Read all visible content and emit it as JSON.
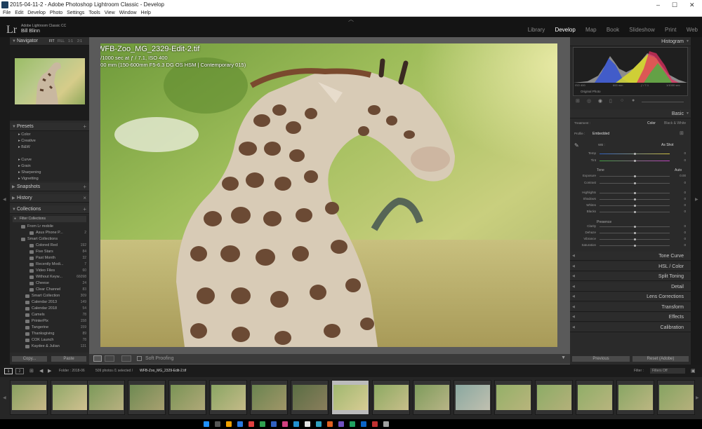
{
  "window": {
    "title": "2015-04-11-2 - Adobe Photoshop Lightroom Classic - Develop",
    "controls": [
      "–",
      "☐",
      "✕"
    ]
  },
  "menu": [
    "File",
    "Edit",
    "Develop",
    "Photo",
    "Settings",
    "Tools",
    "View",
    "Window",
    "Help"
  ],
  "brand": {
    "logo": "Lr",
    "product": "Adobe Lightroom Classic CC",
    "user": "Bill Blinn"
  },
  "modules": [
    "Library",
    "Develop",
    "Map",
    "Book",
    "Slideshow",
    "Print",
    "Web"
  ],
  "navigator": {
    "title": "Navigator",
    "zoom": [
      "FIT",
      "FILL",
      "1:1",
      "2:1"
    ]
  },
  "presets": {
    "title": "Presets",
    "items": [
      "Color",
      "Creative",
      "B&W",
      "",
      "Curve",
      "Grain",
      "Sharpening",
      "Vignetting"
    ]
  },
  "panels_left": {
    "snapshots": "Snapshots",
    "history": "History",
    "collections": "Collections",
    "filter": "Filter Collections"
  },
  "collections": [
    {
      "label": "From Lr mobile",
      "count": ""
    },
    {
      "label": "Asus Phone P...",
      "count": "2"
    },
    {
      "label": "Smart Collections",
      "count": ""
    },
    {
      "label": "Colored Red",
      "count": "192"
    },
    {
      "label": "Five Stars",
      "count": "84"
    },
    {
      "label": "Past Month",
      "count": "32"
    },
    {
      "label": "Recently Modi...",
      "count": "7"
    },
    {
      "label": "Video Files",
      "count": "60"
    },
    {
      "label": "Without Keyw...",
      "count": "66098"
    },
    {
      "label": "Cheese",
      "count": "24"
    },
    {
      "label": "Clear Channel",
      "count": "83"
    },
    {
      "label": "Smart Collection",
      "count": "309"
    },
    {
      "label": "Calendar 2013",
      "count": "149"
    },
    {
      "label": "Calendar 2018",
      "count": "54"
    },
    {
      "label": "Camels",
      "count": "78"
    },
    {
      "label": "PrinterPix",
      "count": "158"
    },
    {
      "label": "Tangerine",
      "count": "159"
    },
    {
      "label": "Thanksgiving",
      "count": "89"
    },
    {
      "label": "COK Launch",
      "count": "78"
    },
    {
      "label": "Kaydee & Julian",
      "count": "131"
    }
  ],
  "left_buttons": {
    "copy": "Copy...",
    "paste": "Paste"
  },
  "photo_info": {
    "filename": "WFB-Zoo_MG_2329-Edit-2.tif",
    "exposure": "1/1000 sec at ƒ / 7.1, ISO 400",
    "lens": "600 mm (150-600mm F5-6.3 DG OS HSM | Contemporary 015)"
  },
  "histogram": {
    "title": "Histogram",
    "iso": "ISO 400",
    "focal": "600 mm",
    "aperture": "ƒ / 7.1",
    "shutter": "1/1000 sec",
    "original": "Original Photo"
  },
  "basic": {
    "title": "Basic",
    "treatment_label": "Treatment :",
    "color": "Color",
    "bw": "Black & White",
    "profile_label": "Profile :",
    "profile": "Embedded",
    "wb_label": "WB :",
    "wb": "As Shot",
    "tone": "Tone",
    "auto": "Auto",
    "presence": "Presence"
  },
  "sliders": [
    {
      "label": "Temp",
      "value": "0"
    },
    {
      "label": "Tint",
      "value": "0"
    },
    {
      "label": "Exposure",
      "value": "0.00"
    },
    {
      "label": "Contrast",
      "value": "0"
    },
    {
      "label": "Highlights",
      "value": "0"
    },
    {
      "label": "Shadows",
      "value": "0"
    },
    {
      "label": "Whites",
      "value": "0"
    },
    {
      "label": "Blacks",
      "value": "0"
    },
    {
      "label": "Clarity",
      "value": "0"
    },
    {
      "label": "Dehaze",
      "value": "0"
    },
    {
      "label": "Vibrance",
      "value": "0"
    },
    {
      "label": "Saturation",
      "value": "0"
    }
  ],
  "right_sections": [
    "Tone Curve",
    "HSL / Color",
    "Split Toning",
    "Detail",
    "Lens Corrections",
    "Transform",
    "Effects",
    "Calibration"
  ],
  "right_buttons": {
    "previous": "Previous",
    "reset": "Reset (Adobe)"
  },
  "toolbar": {
    "soft_proofing": "Soft Proofing"
  },
  "filmstrip_bar": {
    "pages": [
      "1",
      "2"
    ],
    "folder": "Folder : 2018-06",
    "count": "509 photos /1 selected /",
    "current": "WFB-Zoo_MG_2329-Edit-2.tif",
    "filter_label": "Filter :",
    "filter": "Filters Off"
  },
  "colors": {
    "accent": "#0a64c8",
    "panel": "#2a2a2a",
    "bg": "#1f1f1f"
  }
}
